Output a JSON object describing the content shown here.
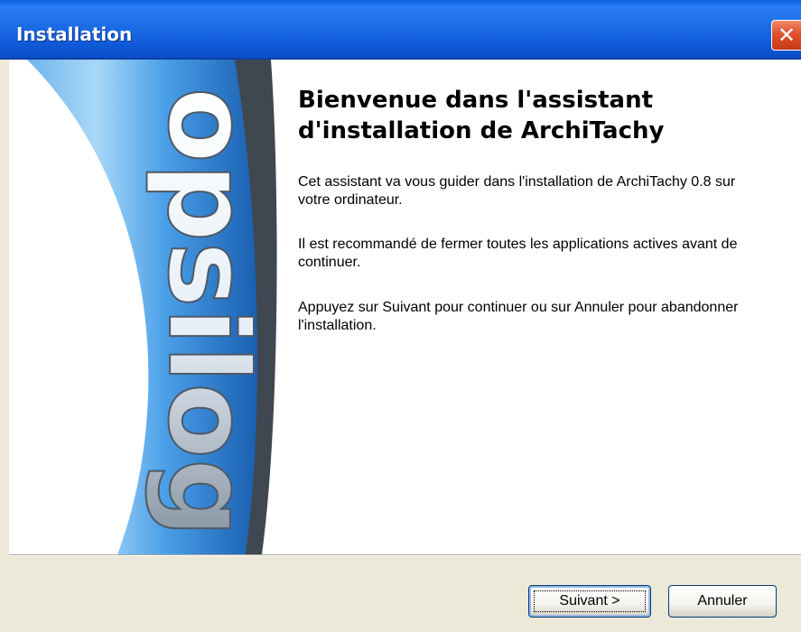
{
  "window": {
    "title": "Installation",
    "close_glyph": "✕"
  },
  "welcome": {
    "heading": "Bienvenue dans l'assistant d'installation de ArchiTachy",
    "paragraphs": [
      "Cet assistant va vous guider dans l'installation de ArchiTachy 0.8 sur votre ordinateur.",
      "Il est recommandé de fermer toutes les applications actives avant de continuer.",
      "Appuyez sur Suivant pour continuer ou sur Annuler pour abandonner l'installation."
    ]
  },
  "side_banner": {
    "logo_text": "opsilog",
    "colors": {
      "blue_light": "#a8d8f8",
      "blue_mid": "#4a9fe8",
      "blue_dark": "#1a5fb0"
    }
  },
  "buttons": {
    "next_label": "Suivant >",
    "cancel_label": "Annuler"
  },
  "colors": {
    "titlebar": "#0e58d6",
    "window_bg": "#ece9d8",
    "close_button": "#e0512d"
  }
}
